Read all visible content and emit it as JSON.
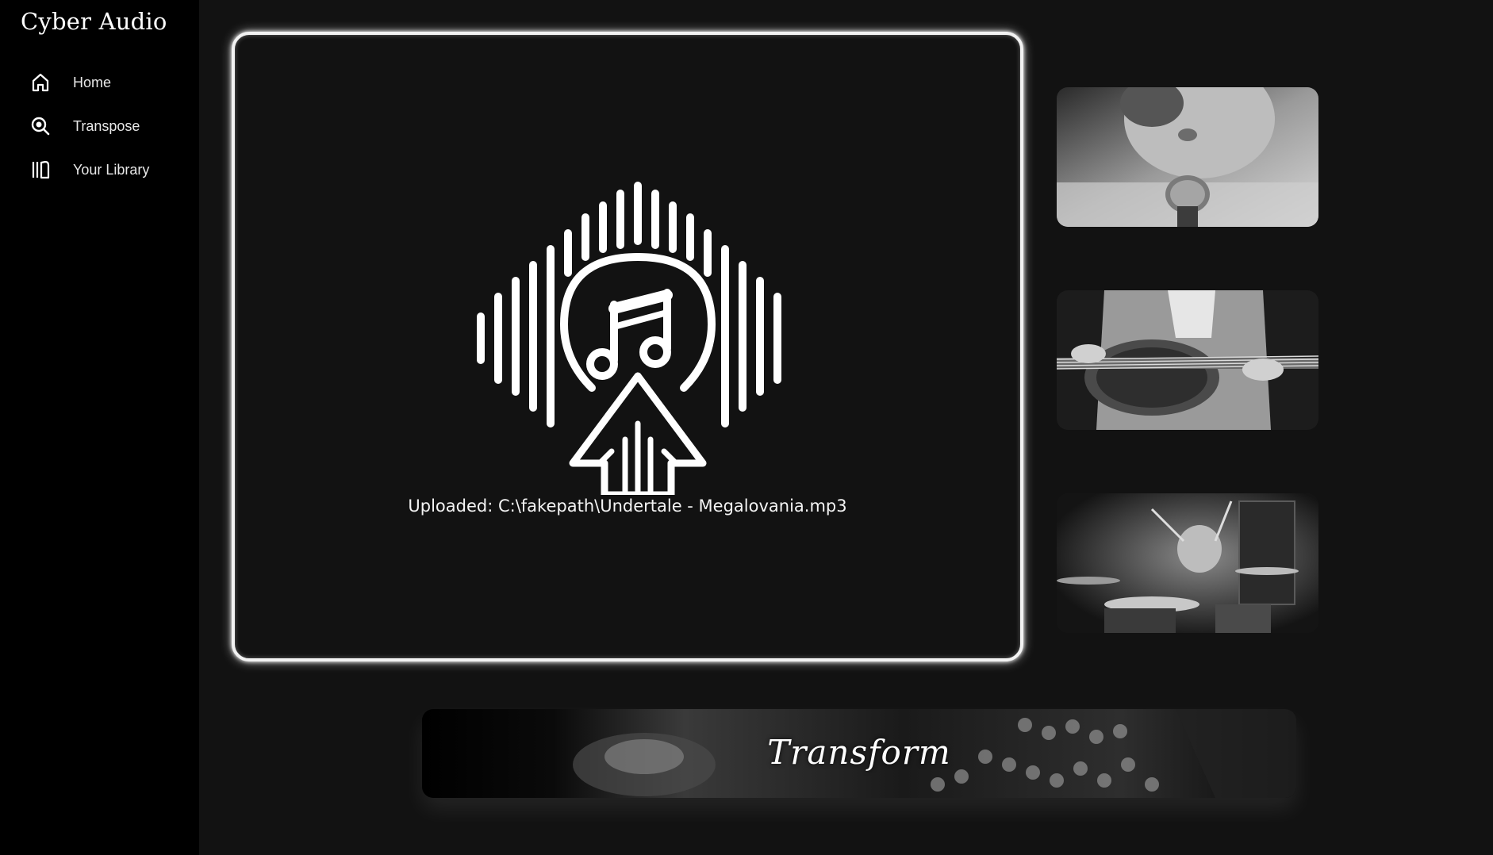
{
  "app": {
    "title": "Cyber Audio"
  },
  "sidebar": {
    "items": [
      {
        "label": "Home",
        "icon": "home-icon"
      },
      {
        "label": "Transpose",
        "icon": "search-icon"
      },
      {
        "label": "Your Library",
        "icon": "library-icon"
      }
    ]
  },
  "upload": {
    "status": "Uploaded: C:\\fakepath\\Undertale - Megalovania.mp3",
    "icon": "music-upload-icon"
  },
  "gallery": {
    "images": [
      {
        "subject": "singer-with-microphone"
      },
      {
        "subject": "guitarist-playing-guitar"
      },
      {
        "subject": "drummer-playing-drums"
      }
    ]
  },
  "action": {
    "label": "Transform"
  },
  "colors": {
    "background": "#121212",
    "sidebar": "#000000",
    "accent": "#ffffff"
  }
}
